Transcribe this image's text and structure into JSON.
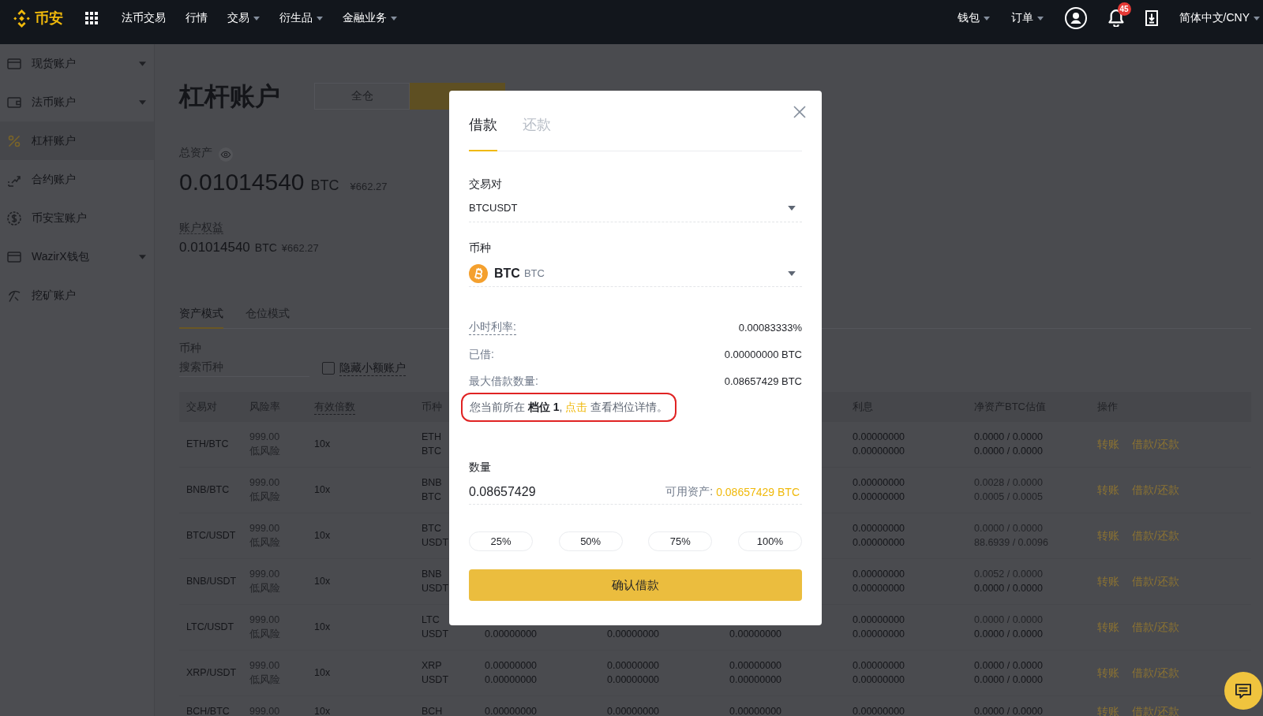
{
  "top_nav": {
    "brand": "币安",
    "menu": [
      {
        "label": "法币交易",
        "dropdown": false
      },
      {
        "label": "行情",
        "dropdown": false
      },
      {
        "label": "交易",
        "dropdown": true
      },
      {
        "label": "衍生品",
        "dropdown": true
      },
      {
        "label": "金融业务",
        "dropdown": true
      }
    ],
    "right_menu": [
      {
        "label": "钱包",
        "dropdown": true
      },
      {
        "label": "订单",
        "dropdown": true
      }
    ],
    "notification_count": "45",
    "language": "简体中文/CNY"
  },
  "sidebar": {
    "items": [
      {
        "label": "现货账户",
        "selected": false,
        "expandable": true
      },
      {
        "label": "法币账户",
        "selected": false,
        "expandable": true
      },
      {
        "label": "杠杆账户",
        "selected": true,
        "expandable": false
      },
      {
        "label": "合约账户",
        "selected": false,
        "expandable": false
      },
      {
        "label": "币安宝账户",
        "selected": false,
        "expandable": false
      },
      {
        "label": "WazirX钱包",
        "selected": false,
        "expandable": true
      },
      {
        "label": "挖矿账户",
        "selected": false,
        "expandable": false
      }
    ]
  },
  "account": {
    "title": "杠杆账户",
    "margin_modes": [
      {
        "label": "全仓",
        "selected": false
      },
      {
        "selected": true
      }
    ],
    "total_assets": {
      "label": "总资产",
      "amount": "0.01014540",
      "unit": "BTC",
      "fiat": "¥662.27"
    },
    "equity": {
      "label": "账户权益",
      "amount": "0.01014540",
      "unit": "BTC",
      "fiat": "¥662.27"
    },
    "tabs": [
      {
        "label": "资产模式",
        "selected": true
      },
      {
        "label": "仓位模式",
        "selected": false
      }
    ],
    "filter": {
      "label": "币种",
      "placeholder": "搜索币种",
      "hide_small": {
        "label": "隐藏小额账户",
        "checked": false
      }
    },
    "table": {
      "columns": [
        {
          "label": "交易对",
          "tooltip": false
        },
        {
          "label": "风险率",
          "tooltip": false
        },
        {
          "label": "有效倍数",
          "tooltip": true
        },
        {
          "label": "币种",
          "tooltip": false
        },
        {
          "label": "利息",
          "tooltip": false
        },
        {
          "label": "净资产BTC估值",
          "tooltip": false
        },
        {
          "label": "操作",
          "tooltip": false
        }
      ],
      "rows": [
        {
          "pair": "ETH/BTC",
          "leverage": "10x",
          "actions": [
            "转账",
            "借款/还款"
          ],
          "lines": [
            {
              "risk": "999.00",
              "coin": "ETH",
              "interest": "0.00000000",
              "net_asset": "0.0000 / 0.0000",
              "net_asset_muted": false
            },
            {
              "risk": "低风险",
              "coin": "BTC",
              "interest": "0.00000000",
              "net_asset": "0.0000 / 0.0000",
              "net_asset_muted": false
            }
          ]
        },
        {
          "pair": "BNB/BTC",
          "leverage": "10x",
          "actions": [
            "转账",
            "借款/还款"
          ],
          "lines": [
            {
              "risk": "999.00",
              "coin": "BNB",
              "interest": "0.00000000",
              "net_asset": "0.0028 / 0.0000",
              "net_asset_muted": true
            },
            {
              "risk": "低风险",
              "coin": "BTC",
              "interest": "0.00000000",
              "net_asset": "0.0005 / 0.0005",
              "net_asset_muted": true
            }
          ]
        },
        {
          "pair": "BTC/USDT",
          "leverage": "10x",
          "actions": [
            "转账",
            "借款/还款"
          ],
          "lines": [
            {
              "risk": "999.00",
              "coin": "BTC",
              "interest": "0.00000000",
              "net_asset": "0.0000 / 0.0000",
              "net_asset_muted": true
            },
            {
              "risk": "低风险",
              "coin": "USDT",
              "interest": "0.00000000",
              "net_asset": "88.6939 / 0.0096",
              "net_asset_muted": true
            }
          ]
        },
        {
          "pair": "BNB/USDT",
          "leverage": "10x",
          "actions": [
            "转账",
            "借款/还款"
          ],
          "lines": [
            {
              "risk": "999.00",
              "coin": "BNB",
              "interest": "0.00000000",
              "net_asset": "0.0052 / 0.0000",
              "net_asset_muted": true
            },
            {
              "risk": "低风险",
              "coin": "USDT",
              "interest": "0.00000000",
              "net_asset": "0.0000 / 0.0000",
              "net_asset_muted": false
            }
          ]
        },
        {
          "pair": "LTC/USDT",
          "leverage": "10x",
          "actions": [
            "转账",
            "借款/还款"
          ],
          "lines": [
            {
              "risk": "999.00",
              "coin": "LTC",
              "interest": "0.00000000",
              "net_asset": "0.0000 / 0.0000",
              "net_asset_muted": true
            },
            {
              "risk": "低风险",
              "coin": "USDT",
              "column_5": "0.00000000",
              "column_6": "0.00000000",
              "column_7": "0.00000000",
              "interest": "0.00000000",
              "net_asset": "0.0000 / 0.0000",
              "net_asset_muted": false
            }
          ]
        },
        {
          "pair": "XRP/USDT",
          "leverage": "10x",
          "actions": [
            "转账",
            "借款/还款"
          ],
          "lines": [
            {
              "risk": "999.00",
              "coin": "XRP",
              "column_5": "0.00000000",
              "column_6": "0.00000000",
              "column_7": "0.00000000",
              "interest": "0.00000000",
              "net_asset": "0.0000 / 0.0000",
              "net_asset_muted": false
            },
            {
              "risk": "低风险",
              "coin": "USDT",
              "column_5": "0.00000000",
              "column_6": "0.00000000",
              "column_7": "0.00000000",
              "interest": "0.00000000",
              "net_asset": "0.0000 / 0.0000",
              "net_asset_muted": false
            }
          ]
        },
        {
          "pair": "BCH/BTC",
          "leverage": "10x",
          "actions": [
            "转账",
            "借款/还款"
          ],
          "lines": [
            {
              "risk": "999.00",
              "coin": "BCH",
              "column_5": "0.00000000",
              "column_6": "0.00000000",
              "column_7": "0.00000000",
              "interest": "0.00000000",
              "net_asset": "0.0000 / 0.0000",
              "net_asset_muted": false
            }
          ]
        }
      ]
    }
  },
  "borrow_dialog": {
    "tabs": [
      {
        "label": "借款",
        "selected": true
      },
      {
        "label": "还款",
        "selected": false
      }
    ],
    "pair": {
      "label": "交易对",
      "value": "BTCUSDT"
    },
    "coin": {
      "label": "币种",
      "symbol": "BTC",
      "name": "BTC"
    },
    "info": [
      {
        "label": "小时利率:",
        "value": "0.00083333%",
        "tooltip": true
      },
      {
        "label": "已借:",
        "value": "0.00000000 BTC",
        "tooltip": false
      },
      {
        "label": "最大借款数量:",
        "value": "0.08657429 BTC",
        "tooltip": false
      }
    ],
    "tier_note": {
      "text": "您当前所在 **档位 1**,",
      "link": "点击",
      "after": "查看档位详情。",
      "highlighted": true
    },
    "amount": {
      "label": "数量",
      "value": "0.08657429",
      "available_label": "可用资产:",
      "available": "0.08657429 BTC"
    },
    "percent_buttons": [
      "25%",
      "50%",
      "75%",
      "100%"
    ],
    "confirm": "确认借款"
  }
}
